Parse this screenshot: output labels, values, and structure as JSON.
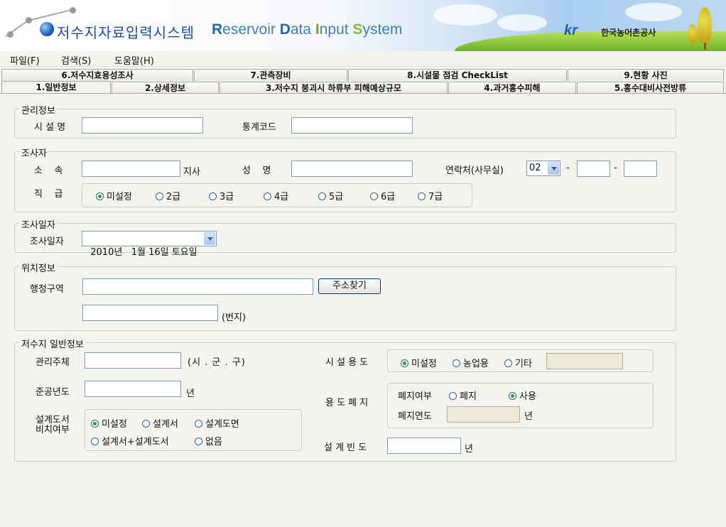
{
  "banner": {
    "title_ko": "저수지자료입력시스템",
    "title_en_parts": [
      "R",
      "eservoir ",
      "D",
      "ata ",
      "I",
      "nput ",
      "S",
      "ystem"
    ],
    "org_logo": "kr",
    "org_name": "한국농어촌공사"
  },
  "menu": [
    "파일(F)",
    "검색(S)",
    "도움말(H)"
  ],
  "tabs_row1": [
    "6.저수지효용성조사",
    "7.관측장비",
    "8.시설물 점검 CheckList",
    "9.현황 사진"
  ],
  "tabs_row2": [
    "1.일반정보",
    "2.상세정보",
    "3.저수지 붕괴시 하류부 피해예상규모",
    "4.과거홍수피해",
    "5.홍수대비사전방류"
  ],
  "mgmt": {
    "legend": "관리정보",
    "facility_name_label": "시 설 명",
    "facility_name_value": "",
    "stat_code_label": "통계코드",
    "stat_code_value": ""
  },
  "investigator": {
    "legend": "조사자",
    "affiliation_label": "소    속",
    "affiliation_value": "",
    "branch_suffix": "지사",
    "name_label": "성    명",
    "name_value": "",
    "contact_label": "연락처(사무실)",
    "area_code": "02",
    "phone_mid": "",
    "phone_last": "",
    "dash": "-",
    "rank_label": "직    급",
    "ranks": [
      "미설정",
      "2급",
      "3급",
      "4급",
      "5급",
      "6급",
      "7급"
    ],
    "rank_selected": "미설정"
  },
  "survey_date": {
    "legend": "조사일자",
    "label": "조사일자",
    "value": "2010년   1월 16일 토요일"
  },
  "location": {
    "legend": "위치정보",
    "admin_label": "행정구역",
    "admin_value": "",
    "find_button": "주소찾기",
    "lot_value": "",
    "lot_suffix": "(번지)"
  },
  "general": {
    "legend": "저수지 일반정보",
    "manager_label": "관리주체",
    "manager_value": "",
    "manager_suffix": "(시 . 군 . 구)",
    "completion_label": "준공년도",
    "completion_value": "",
    "year_suffix": "년",
    "design_doc_label_1": "설계도서",
    "design_doc_label_2": "비치여부",
    "design_doc_options": [
      "미설정",
      "설계서",
      "설계도면",
      "설계서+설계도서",
      "없음"
    ],
    "design_doc_selected": "미설정",
    "usage_label": "시 설 용 도",
    "usage_options": [
      "미설정",
      "농업용",
      "기타"
    ],
    "usage_selected": "미설정",
    "usage_other_value": "",
    "abolish_label": "용 도 폐 지",
    "abolish_status_label": "폐지여부",
    "abolish_options": [
      "폐지",
      "사용"
    ],
    "abolish_selected": "사용",
    "abolish_year_label": "폐지연도",
    "abolish_year_value": "",
    "design_freq_label": "설 계 빈 도",
    "design_freq_value": ""
  }
}
